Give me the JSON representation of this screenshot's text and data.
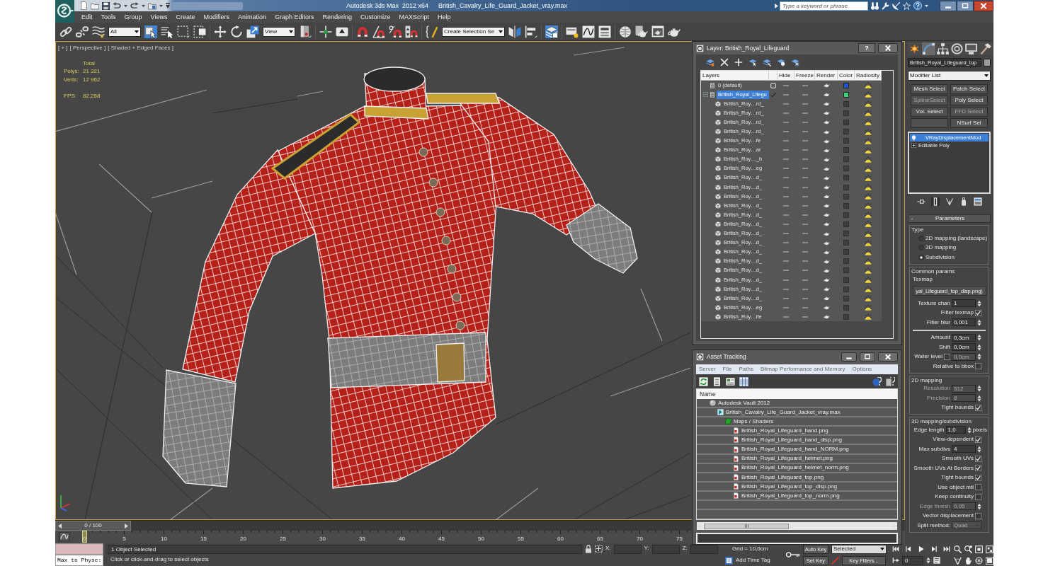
{
  "title_bar": {
    "app_title": "Autodesk 3ds Max  2012 x64",
    "file_name": "British_Cavalry_Life_Guard_Jacket_vray.max",
    "search": {
      "placeholder": "Type a keyword or phrase"
    }
  },
  "menu": [
    "Edit",
    "Tools",
    "Group",
    "Views",
    "Create",
    "Modifiers",
    "Animation",
    "Graph Editors",
    "Rendering",
    "Customize",
    "MAXScript",
    "Help"
  ],
  "main_toolbar": [
    {
      "kind": "icon",
      "selected": false
    },
    {
      "kind": "icon",
      "selected": false
    },
    {
      "kind": "icon",
      "selected": false
    },
    {
      "kind": "dropdown",
      "value": "All"
    },
    {
      "kind": "icon",
      "selected": true
    },
    {
      "kind": "icon",
      "selected": false
    },
    {
      "kind": "icon",
      "selected": false
    },
    {
      "kind": "icon",
      "selected": false
    },
    {
      "kind": "separator"
    },
    {
      "kind": "icon",
      "selected": false
    },
    {
      "kind": "icon",
      "selected": false
    },
    {
      "kind": "icon",
      "selected": false
    },
    {
      "kind": "dropdown",
      "value": "View"
    },
    {
      "kind": "icon",
      "selected": false
    },
    {
      "kind": "separator"
    },
    {
      "kind": "icon",
      "selected": false
    },
    {
      "kind": "icon",
      "selected": false
    },
    {
      "kind": "separator"
    },
    {
      "kind": "icon",
      "selected": false
    },
    {
      "kind": "icon",
      "selected": false
    },
    {
      "kind": "icon",
      "selected": false
    },
    {
      "kind": "icon",
      "selected": false
    },
    {
      "kind": "separator"
    },
    {
      "kind": "icon",
      "selected": false
    },
    {
      "kind": "dropdown",
      "value": "Create Selection Se"
    },
    {
      "kind": "icon",
      "selected": false
    },
    {
      "kind": "icon",
      "selected": false
    },
    {
      "kind": "separator"
    },
    {
      "kind": "icon",
      "selected": true
    },
    {
      "kind": "separator"
    },
    {
      "kind": "icon",
      "selected": false
    },
    {
      "kind": "icon",
      "selected": false
    },
    {
      "kind": "icon",
      "selected": false
    },
    {
      "kind": "separator"
    },
    {
      "kind": "icon",
      "selected": false
    },
    {
      "kind": "icon",
      "selected": false
    },
    {
      "kind": "icon",
      "selected": false
    },
    {
      "kind": "icon",
      "selected": false
    }
  ],
  "viewport": {
    "label": [
      "[ + ]",
      "[ Perspective ]",
      "[ Shaded + Edged Faces ]"
    ],
    "stats_title": "Total",
    "stats": [
      {
        "label": "Polys:",
        "value": "21 321"
      },
      {
        "label": "Verts:",
        "value": "12 962"
      }
    ],
    "fps": {
      "label": "FPS:",
      "value": "82,268"
    }
  },
  "layer_manager": {
    "title": "Layer: British_Royal_Lifeguard",
    "help": "?",
    "columns": [
      "Layers",
      "Hide",
      "Freeze",
      "Render",
      "Color",
      "Radiosity"
    ],
    "layers": [
      {
        "kind": "layer",
        "name": "0 (default)",
        "selected": false,
        "current": false,
        "color": "#1f55c8"
      },
      {
        "kind": "layer",
        "name": "British_Royal_Lifegu",
        "selected": true,
        "current": true,
        "expanded": true,
        "color": "#3fd07c",
        "children": [
          {
            "kind": "object",
            "name": "British_Roy…rd_",
            "selected": false
          },
          {
            "kind": "object",
            "name": "British_Roy…rd_",
            "selected": false
          },
          {
            "kind": "object",
            "name": "British_Roy…rd_",
            "selected": false
          },
          {
            "kind": "object",
            "name": "British_Roy…rd_",
            "selected": false
          },
          {
            "kind": "object",
            "name": "British_Roy…fe",
            "selected": false
          },
          {
            "kind": "object",
            "name": "British_Roy…ar",
            "selected": false
          },
          {
            "kind": "object",
            "name": "British_Roy…_b",
            "selected": false
          },
          {
            "kind": "object",
            "name": "British_Roy…eg",
            "selected": false
          },
          {
            "kind": "object",
            "name": "British_Roy…d_",
            "selected": false
          },
          {
            "kind": "object",
            "name": "British_Roy…d_",
            "selected": false
          },
          {
            "kind": "object",
            "name": "British_Roy…d_",
            "selected": false
          },
          {
            "kind": "object",
            "name": "British_Roy…d_",
            "selected": false
          },
          {
            "kind": "object",
            "name": "British_Roy…d_",
            "selected": false
          },
          {
            "kind": "object",
            "name": "British_Roy…d_",
            "selected": false
          },
          {
            "kind": "object",
            "name": "British_Roy…d_",
            "selected": false
          },
          {
            "kind": "object",
            "name": "British_Roy…d_",
            "selected": false
          },
          {
            "kind": "object",
            "name": "British_Roy…d_",
            "selected": false
          },
          {
            "kind": "object",
            "name": "British_Roy…d_",
            "selected": false
          },
          {
            "kind": "object",
            "name": "British_Roy…d_",
            "selected": false
          },
          {
            "kind": "object",
            "name": "British_Roy…d_",
            "selected": false
          },
          {
            "kind": "object",
            "name": "British_Roy…d_",
            "selected": false
          },
          {
            "kind": "object",
            "name": "British_Roy…d_",
            "selected": false
          },
          {
            "kind": "object",
            "name": "British_Roy…eg",
            "selected": false
          },
          {
            "kind": "object",
            "name": "British_Roy…ife",
            "selected": false
          }
        ]
      }
    ]
  },
  "asset_tracking": {
    "title": "Asset Tracking",
    "menu": [
      "Server",
      "File",
      "Paths",
      "Bitmap Performance and Memory",
      "Options"
    ],
    "toolbar": [
      {
        "selected": false
      },
      {
        "selected": false
      },
      {
        "selected": false
      },
      {
        "selected": true
      }
    ],
    "column": "Name",
    "tree": [
      {
        "kind": "vault",
        "name": "Autodesk Vault 2012",
        "children": [
          {
            "kind": "scene",
            "name": "British_Cavalry_Life_Guard_Jacket_vray.max",
            "children": [
              {
                "kind": "folder",
                "name": "Maps / Shaders",
                "children": [
                  {
                    "kind": "bitmap",
                    "name": "British_Royal_Lifeguard_hand.png"
                  },
                  {
                    "kind": "bitmap",
                    "name": "British_Royal_Lifeguard_hand_disp.png"
                  },
                  {
                    "kind": "bitmap",
                    "name": "British_Royal_Lifeguard_hand_NORM.png"
                  },
                  {
                    "kind": "bitmap",
                    "name": "British_Royal_Lifeguard_helmet.png"
                  },
                  {
                    "kind": "bitmap",
                    "name": "British_Royal_Lifeguard_helmet_norm.png"
                  },
                  {
                    "kind": "bitmap",
                    "name": "British_Royal_Lifeguard_top.png"
                  },
                  {
                    "kind": "bitmap",
                    "name": "British_Royal_Lifeguard_top_disp.png"
                  },
                  {
                    "kind": "bitmap",
                    "name": "British_Royal_Lifeguard_top_norm.png"
                  }
                ]
              }
            ]
          }
        ]
      }
    ]
  },
  "command_panel": {
    "tabs": [
      {
        "selected": false
      },
      {
        "selected": true
      },
      {
        "selected": false
      },
      {
        "selected": false
      },
      {
        "selected": false
      },
      {
        "selected": false
      }
    ],
    "object_name": "British_Royal_Lifeguard_top",
    "modifier_list": "Modifier List",
    "modifier_buttons": [
      {
        "kind": "button",
        "label": "Mesh Select",
        "disabled": false
      },
      {
        "kind": "button",
        "label": "Patch Select",
        "disabled": false
      },
      {
        "kind": "button",
        "label": "SplineSelect",
        "disabled": true
      },
      {
        "kind": "button",
        "label": "Poly Select",
        "disabled": false
      },
      {
        "kind": "button",
        "label": "Vol. Select",
        "disabled": false
      },
      {
        "kind": "button",
        "label": "FFD Select",
        "disabled": true
      },
      {
        "kind": "blank"
      },
      {
        "kind": "button",
        "label": "NSurf Sel",
        "disabled": false
      }
    ],
    "stack": [
      {
        "kind": "modifier",
        "name": "VRayDisplacementMod",
        "selected": true
      },
      {
        "kind": "base",
        "name": "Editable Poly",
        "selected": false
      }
    ],
    "stack_tools": [
      {
        "selected": false
      },
      {
        "selected": true
      },
      {
        "selected": false
      },
      {
        "selected": false
      },
      {
        "selected": false
      }
    ],
    "rollout": {
      "sign": "-",
      "title": "Parameters",
      "groups": [
        {
          "title": "Type",
          "rows": [
            {
              "kind": "radio",
              "label": "2D mapping (landscape)",
              "selected": false
            },
            {
              "kind": "radio",
              "label": "3D mapping",
              "selected": false
            },
            {
              "kind": "radio",
              "label": "Subdivision",
              "selected": true
            }
          ]
        },
        {
          "title": "Common params",
          "rows": [
            {
              "kind": "caption",
              "label": "Texmap"
            },
            {
              "kind": "map_button",
              "label": "yal_Lifeguard_top_disp.png)"
            },
            {
              "kind": "spinner",
              "label": "Texture chan",
              "value": "1",
              "disabled": false
            },
            {
              "kind": "checkbox",
              "label": "Filter texmap",
              "checked": true
            },
            {
              "kind": "spinner",
              "label": "Filter blur",
              "value": "0,001",
              "disabled": false
            },
            {
              "kind": "rule"
            },
            {
              "kind": "spinner",
              "label": "Amount",
              "value": "0,3cm",
              "disabled": false
            },
            {
              "kind": "spinner",
              "label": "Shift",
              "value": "0,0cm",
              "disabled": false
            },
            {
              "kind": "check_spinner",
              "label": "Water level",
              "checked": false,
              "value": "0,0cm",
              "disabled": true
            },
            {
              "kind": "checkbox",
              "label": "Relative to bbox",
              "checked": false
            }
          ]
        },
        {
          "title": "2D mapping",
          "rows": [
            {
              "kind": "spinner",
              "label": "Resolution",
              "value": "512",
              "disabled": true
            },
            {
              "kind": "spinner",
              "label": "Precision",
              "value": "8",
              "disabled": true
            },
            {
              "kind": "checkbox",
              "label": "Tight bounds",
              "checked": true
            }
          ]
        },
        {
          "title": "3D mapping/subdivision",
          "rows": [
            {
              "kind": "spinner",
              "label": "Edge length",
              "value": "1,0",
              "unit": "pixels",
              "disabled": false
            },
            {
              "kind": "checkbox",
              "label": "View-dependent",
              "checked": true
            },
            {
              "kind": "spinner",
              "label": "Max subdivs",
              "value": "4",
              "disabled": false
            },
            {
              "kind": "checkbox",
              "label": "Smooth UVs",
              "checked": true
            },
            {
              "kind": "checkbox",
              "label": "Smooth UVs At Borders",
              "checked": true
            },
            {
              "kind": "checkbox",
              "label": "Tight bounds",
              "checked": true
            },
            {
              "kind": "checkbox",
              "label": "Use object mtl",
              "checked": false
            },
            {
              "kind": "checkbox",
              "label": "Keep continuity",
              "checked": false
            },
            {
              "kind": "spinner",
              "label": "Edge thresh",
              "value": "0,05",
              "disabled": true
            },
            {
              "kind": "checkbox",
              "label": "Vector displacement",
              "checked": false
            },
            {
              "kind": "dropdown",
              "label": "Split method:",
              "value": "Quad",
              "disabled": true
            }
          ]
        }
      ]
    }
  },
  "time_slider": {
    "frame": "0 / 100",
    "level": 0
  },
  "track_bar": {
    "ticks": [
      "0",
      "5",
      "10",
      "15",
      "20",
      "25",
      "30",
      "35",
      "40",
      "45",
      "50",
      "55",
      "60",
      "65",
      "70",
      "75"
    ]
  },
  "status_bar": {
    "listener_label": "Max to Physc:",
    "selection": "1 Object Selected",
    "prompt": "Click or click-and-drag to select objects",
    "coords": [
      "X:",
      "Y:",
      "Z:"
    ],
    "grid": "Grid = 10,0cm",
    "time_tag": "Add Time Tag",
    "auto_key": "Auto Key",
    "key_mode": "Selected",
    "set_key": "Set Key",
    "key_filters": "Key Filters...",
    "frame": "0"
  }
}
